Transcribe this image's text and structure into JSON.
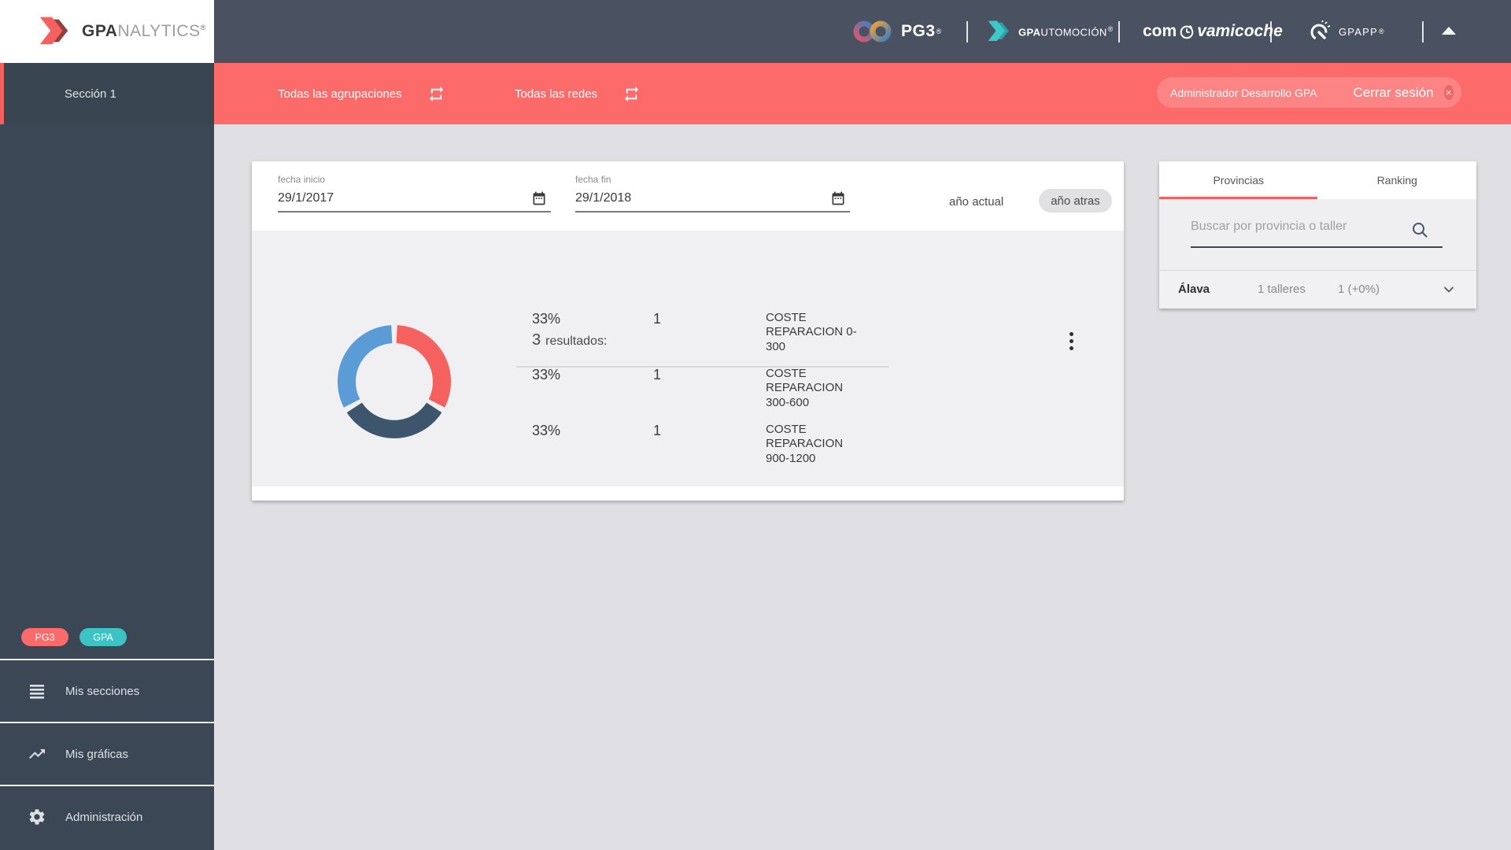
{
  "header": {
    "brand": {
      "gpa": "GPA",
      "nalytics": "NALYTICS",
      "reg": "®"
    },
    "pg3": {
      "label": "PG3",
      "reg": "®"
    },
    "gpautomocion": {
      "gpa": "GPA",
      "rest": "UTOMOCIÓN",
      "reg": "®"
    },
    "comprovamicoche": {
      "pre": "com",
      "post": "vamicoche"
    },
    "gpapp": {
      "label": "GPAPP",
      "reg": "®"
    },
    "collapse_icon": ""
  },
  "sidebar": {
    "active_section": "Sección 1",
    "badges": [
      {
        "label": "PG3",
        "color": "#FB6B6B"
      },
      {
        "label": "GPA",
        "color": "#3EC3C5"
      }
    ],
    "items": [
      {
        "label": "Mis secciones",
        "icon": "list-icon"
      },
      {
        "label": "Mis gráficas",
        "icon": "trending-up-icon"
      },
      {
        "label": "Administración",
        "icon": "gear-icon"
      }
    ]
  },
  "filter_bar": {
    "groupings_label": "Todas las agrupaciones",
    "networks_label": "Todas las redes",
    "user_chip": {
      "user": "Administrador Desarrollo GPA",
      "logout": "Cerrar sesión",
      "close_icon": "×"
    }
  },
  "chart_card": {
    "date_start": {
      "label": "fecha inicio",
      "value": "29/1/2017"
    },
    "date_end": {
      "label": "fecha fin",
      "value": "29/1/2018"
    },
    "current_year_button": "año actual",
    "year_ago_button": "año atras",
    "results": {
      "count": "3",
      "label": "resultados:"
    },
    "rows": [
      {
        "percent": "33%",
        "count": "1",
        "label": "COSTE REPARACION 0-300"
      },
      {
        "percent": "33%",
        "count": "1",
        "label": "COSTE REPARACION 300-600"
      },
      {
        "percent": "33%",
        "count": "1",
        "label": "COSTE REPARACION 900-1200"
      }
    ]
  },
  "chart_data": {
    "type": "pie",
    "subtype": "donut",
    "categories": [
      "COSTE REPARACION 0-300",
      "COSTE REPARACION 300-600",
      "COSTE REPARACION 900-1200"
    ],
    "values": [
      1,
      1,
      1
    ],
    "percentages": [
      33,
      33,
      33
    ],
    "colors": [
      "#F5615E",
      "#3E566D",
      "#5C9CD6"
    ],
    "title": "",
    "legend_position": "none"
  },
  "side_panel": {
    "tabs": [
      {
        "label": "Provincias",
        "active": true
      },
      {
        "label": "Ranking",
        "active": false
      }
    ],
    "search_placeholder": "Buscar por provincia o taller",
    "provinces": [
      {
        "name": "Álava",
        "talleres": "1 talleres",
        "growth": "1 (+0%)"
      }
    ]
  },
  "colors": {
    "accent_red": "#FC6A6A",
    "accent_teal": "#3EC3C5",
    "header_bg": "#4A5262",
    "sidebar_bg": "#3B4754",
    "page_bg": "#E0E0E4",
    "card_gray": "#F0F0F2"
  },
  "icons": {
    "repeat": "swap-arrows",
    "calendar": "date-range",
    "search": "magnifier",
    "kebab": "three-dots-vertical",
    "chevron": "chevron-down",
    "collapse": "triangle-up"
  }
}
